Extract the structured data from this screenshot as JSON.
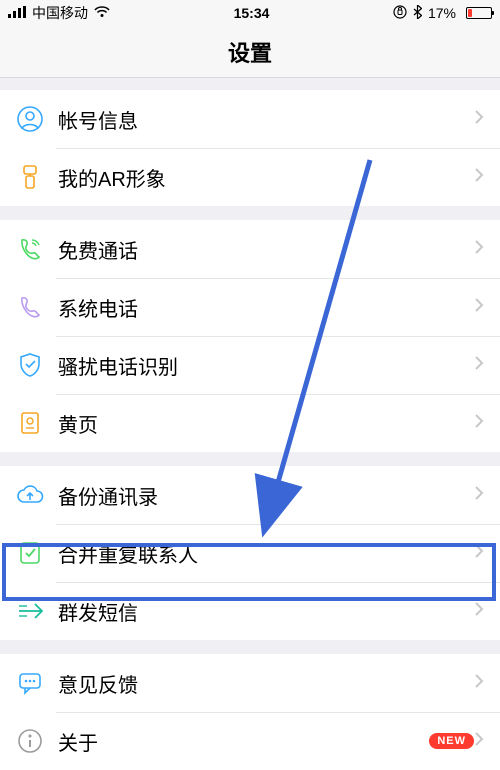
{
  "status": {
    "carrier": "中国移动",
    "time": "15:34",
    "battery_pct": "17%"
  },
  "nav": {
    "title": "设置"
  },
  "groups": [
    {
      "rows": [
        {
          "label": "帐号信息",
          "icon": "person-icon",
          "color": "#36a9ff"
        },
        {
          "label": "我的AR形象",
          "icon": "ar-icon",
          "color": "#f5a623"
        }
      ]
    },
    {
      "rows": [
        {
          "label": "免费通话",
          "icon": "phone-free-icon",
          "color": "#4cd964"
        },
        {
          "label": "系统电话",
          "icon": "phone-icon",
          "color": "#b99cf2"
        },
        {
          "label": "骚扰电话识别",
          "icon": "shield-icon",
          "color": "#36a9ff"
        },
        {
          "label": "黄页",
          "icon": "book-icon",
          "color": "#f5a623"
        }
      ]
    },
    {
      "rows": [
        {
          "label": "备份通讯录",
          "icon": "cloud-up-icon",
          "color": "#36a9ff"
        },
        {
          "label": "合并重复联系人",
          "icon": "merge-icon",
          "color": "#4cd964"
        },
        {
          "label": "群发短信",
          "icon": "send-icon",
          "color": "#1abc9c"
        }
      ]
    },
    {
      "rows": [
        {
          "label": "意见反馈",
          "icon": "feedback-icon",
          "color": "#36a9ff"
        },
        {
          "label": "关于",
          "icon": "info-icon",
          "color": "#9b9b9b",
          "badge": "NEW"
        }
      ]
    }
  ]
}
